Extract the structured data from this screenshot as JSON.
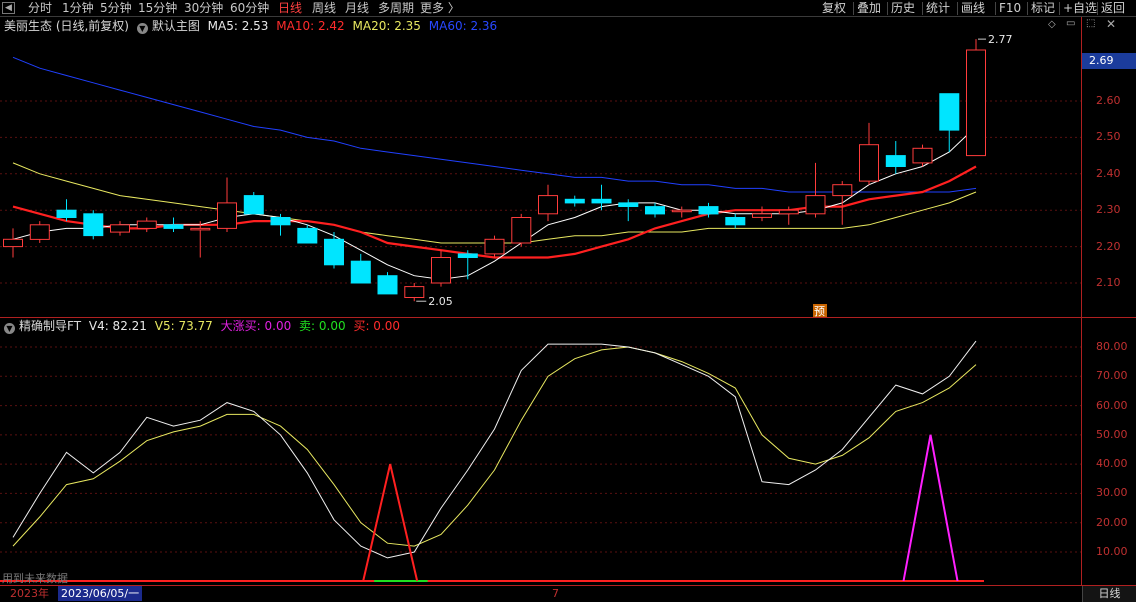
{
  "toolbar": {
    "timeframes": [
      "分时",
      "1分钟",
      "5分钟",
      "15分钟",
      "30分钟",
      "60分钟",
      "日线",
      "周线",
      "月线",
      "多周期",
      "更多 〉"
    ],
    "active_index": 6,
    "right_buttons": [
      "复权",
      "叠加",
      "历史",
      "统计",
      "画线",
      "F10",
      "标记",
      "+自选",
      "返回"
    ]
  },
  "main": {
    "title": "美丽生态 (日线,前复权)",
    "template": "默认主图",
    "ma5": "MA5: 2.53",
    "ma10": "MA10: 2.42",
    "ma20": "MA20: 2.35",
    "ma60": "MA60: 2.36",
    "current_price": "2.69",
    "high_label": "2.77",
    "low_label": "2.05",
    "pre_mark": "预",
    "y_ticks": [
      "2.60",
      "2.50",
      "2.40",
      "2.30",
      "2.20",
      "2.10"
    ]
  },
  "indicator": {
    "title": "精确制导FT",
    "v4": "V4: 82.21",
    "v5": "V5: 73.77",
    "dazhangmai": "大涨买: 0.00",
    "mai1": "卖: 0.00",
    "mai2": "买: 0.00",
    "y_ticks": [
      "80.00",
      "70.00",
      "60.00",
      "50.00",
      "40.00",
      "30.00",
      "20.00",
      "10.00"
    ],
    "watermark": "用到未来数据"
  },
  "bottom": {
    "year": "2023年",
    "date": "2023/06/05/一",
    "month_mark": "7",
    "period": "日线"
  },
  "colors": {
    "up": "#ff3c3c",
    "down": "#00e5ff",
    "ma5": "#ffffff",
    "ma10": "#ff2020",
    "ma20": "#e8e860",
    "ma60": "#2040ff"
  },
  "chart_data": {
    "type": "candlestick",
    "price_range": [
      2.03,
      2.79
    ],
    "candles": [
      {
        "o": 2.2,
        "h": 2.25,
        "l": 2.17,
        "c": 2.22
      },
      {
        "o": 2.22,
        "h": 2.27,
        "l": 2.21,
        "c": 2.26
      },
      {
        "o": 2.3,
        "h": 2.33,
        "l": 2.27,
        "c": 2.28
      },
      {
        "o": 2.29,
        "h": 2.3,
        "l": 2.22,
        "c": 2.23
      },
      {
        "o": 2.24,
        "h": 2.27,
        "l": 2.23,
        "c": 2.26
      },
      {
        "o": 2.25,
        "h": 2.28,
        "l": 2.24,
        "c": 2.27
      },
      {
        "o": 2.26,
        "h": 2.28,
        "l": 2.24,
        "c": 2.25
      },
      {
        "o": 2.25,
        "h": 2.27,
        "l": 2.17,
        "c": 2.25
      },
      {
        "o": 2.25,
        "h": 2.39,
        "l": 2.24,
        "c": 2.32
      },
      {
        "o": 2.34,
        "h": 2.35,
        "l": 2.29,
        "c": 2.29
      },
      {
        "o": 2.28,
        "h": 2.29,
        "l": 2.23,
        "c": 2.26
      },
      {
        "o": 2.25,
        "h": 2.26,
        "l": 2.21,
        "c": 2.21
      },
      {
        "o": 2.22,
        "h": 2.24,
        "l": 2.14,
        "c": 2.15
      },
      {
        "o": 2.16,
        "h": 2.18,
        "l": 2.1,
        "c": 2.1
      },
      {
        "o": 2.12,
        "h": 2.13,
        "l": 2.07,
        "c": 2.07
      },
      {
        "o": 2.06,
        "h": 2.1,
        "l": 2.05,
        "c": 2.09
      },
      {
        "o": 2.1,
        "h": 2.19,
        "l": 2.09,
        "c": 2.17
      },
      {
        "o": 2.18,
        "h": 2.19,
        "l": 2.11,
        "c": 2.17
      },
      {
        "o": 2.18,
        "h": 2.23,
        "l": 2.17,
        "c": 2.22
      },
      {
        "o": 2.21,
        "h": 2.29,
        "l": 2.2,
        "c": 2.28
      },
      {
        "o": 2.29,
        "h": 2.37,
        "l": 2.27,
        "c": 2.34
      },
      {
        "o": 2.33,
        "h": 2.34,
        "l": 2.31,
        "c": 2.32
      },
      {
        "o": 2.33,
        "h": 2.37,
        "l": 2.3,
        "c": 2.32
      },
      {
        "o": 2.32,
        "h": 2.33,
        "l": 2.27,
        "c": 2.31
      },
      {
        "o": 2.31,
        "h": 2.32,
        "l": 2.28,
        "c": 2.29
      },
      {
        "o": 2.3,
        "h": 2.31,
        "l": 2.28,
        "c": 2.3
      },
      {
        "o": 2.31,
        "h": 2.32,
        "l": 2.28,
        "c": 2.29
      },
      {
        "o": 2.28,
        "h": 2.29,
        "l": 2.25,
        "c": 2.26
      },
      {
        "o": 2.28,
        "h": 2.31,
        "l": 2.27,
        "c": 2.29
      },
      {
        "o": 2.29,
        "h": 2.31,
        "l": 2.26,
        "c": 2.3
      },
      {
        "o": 2.29,
        "h": 2.43,
        "l": 2.28,
        "c": 2.34
      },
      {
        "o": 2.34,
        "h": 2.38,
        "l": 2.26,
        "c": 2.37
      },
      {
        "o": 2.38,
        "h": 2.54,
        "l": 2.37,
        "c": 2.48
      },
      {
        "o": 2.45,
        "h": 2.49,
        "l": 2.4,
        "c": 2.42
      },
      {
        "o": 2.43,
        "h": 2.48,
        "l": 2.42,
        "c": 2.47
      },
      {
        "o": 2.62,
        "h": 2.62,
        "l": 2.46,
        "c": 2.52
      },
      {
        "o": 2.45,
        "h": 2.77,
        "l": 2.45,
        "c": 2.74
      }
    ],
    "ma5": [
      2.22,
      2.24,
      2.25,
      2.25,
      2.26,
      2.26,
      2.26,
      2.26,
      2.28,
      2.29,
      2.28,
      2.26,
      2.23,
      2.19,
      2.15,
      2.12,
      2.11,
      2.12,
      2.16,
      2.21,
      2.26,
      2.28,
      2.31,
      2.32,
      2.32,
      2.3,
      2.3,
      2.29,
      2.29,
      2.29,
      2.3,
      2.32,
      2.37,
      2.4,
      2.42,
      2.46,
      2.53
    ],
    "ma10": [
      2.31,
      2.29,
      2.27,
      2.26,
      2.25,
      2.25,
      2.26,
      2.26,
      2.26,
      2.27,
      2.27,
      2.27,
      2.26,
      2.24,
      2.21,
      2.2,
      2.19,
      2.18,
      2.17,
      2.17,
      2.17,
      2.18,
      2.2,
      2.22,
      2.25,
      2.27,
      2.29,
      2.3,
      2.3,
      2.3,
      2.31,
      2.31,
      2.33,
      2.34,
      2.35,
      2.38,
      2.42
    ],
    "ma20": [
      2.43,
      2.4,
      2.38,
      2.36,
      2.34,
      2.33,
      2.32,
      2.31,
      2.3,
      2.29,
      2.28,
      2.27,
      2.26,
      2.24,
      2.23,
      2.22,
      2.21,
      2.21,
      2.21,
      2.21,
      2.22,
      2.23,
      2.23,
      2.24,
      2.24,
      2.24,
      2.25,
      2.25,
      2.25,
      2.25,
      2.25,
      2.25,
      2.26,
      2.28,
      2.3,
      2.32,
      2.35
    ],
    "ma60": [
      2.72,
      2.69,
      2.67,
      2.65,
      2.63,
      2.61,
      2.59,
      2.57,
      2.55,
      2.53,
      2.52,
      2.5,
      2.49,
      2.47,
      2.46,
      2.45,
      2.44,
      2.43,
      2.42,
      2.41,
      2.4,
      2.39,
      2.39,
      2.38,
      2.38,
      2.37,
      2.37,
      2.36,
      2.36,
      2.35,
      2.35,
      2.35,
      2.35,
      2.35,
      2.35,
      2.35,
      2.36
    ],
    "indicator": {
      "v4": [
        15,
        30,
        44,
        37,
        44,
        56,
        53,
        55,
        61,
        58,
        50,
        37,
        21,
        12,
        8,
        10,
        25,
        38,
        52,
        72,
        81,
        81,
        81,
        80,
        78,
        74,
        70,
        63,
        34,
        33,
        38,
        45,
        56,
        67,
        64,
        70,
        82
      ],
      "v5": [
        12,
        22,
        33,
        35,
        41,
        48,
        51,
        53,
        57,
        57,
        53,
        45,
        33,
        20,
        13,
        12,
        16,
        26,
        38,
        55,
        70,
        76,
        79,
        80,
        78,
        75,
        71,
        66,
        50,
        42,
        40,
        43,
        49,
        58,
        61,
        66,
        74
      ],
      "dazhangmai_spikes": [
        {
          "index": 36,
          "value": 40
        }
      ],
      "mai_spikes": [
        {
          "index": 37.4,
          "value": 50
        }
      ],
      "mai_green_range": [
        13.5,
        15.5
      ]
    }
  }
}
